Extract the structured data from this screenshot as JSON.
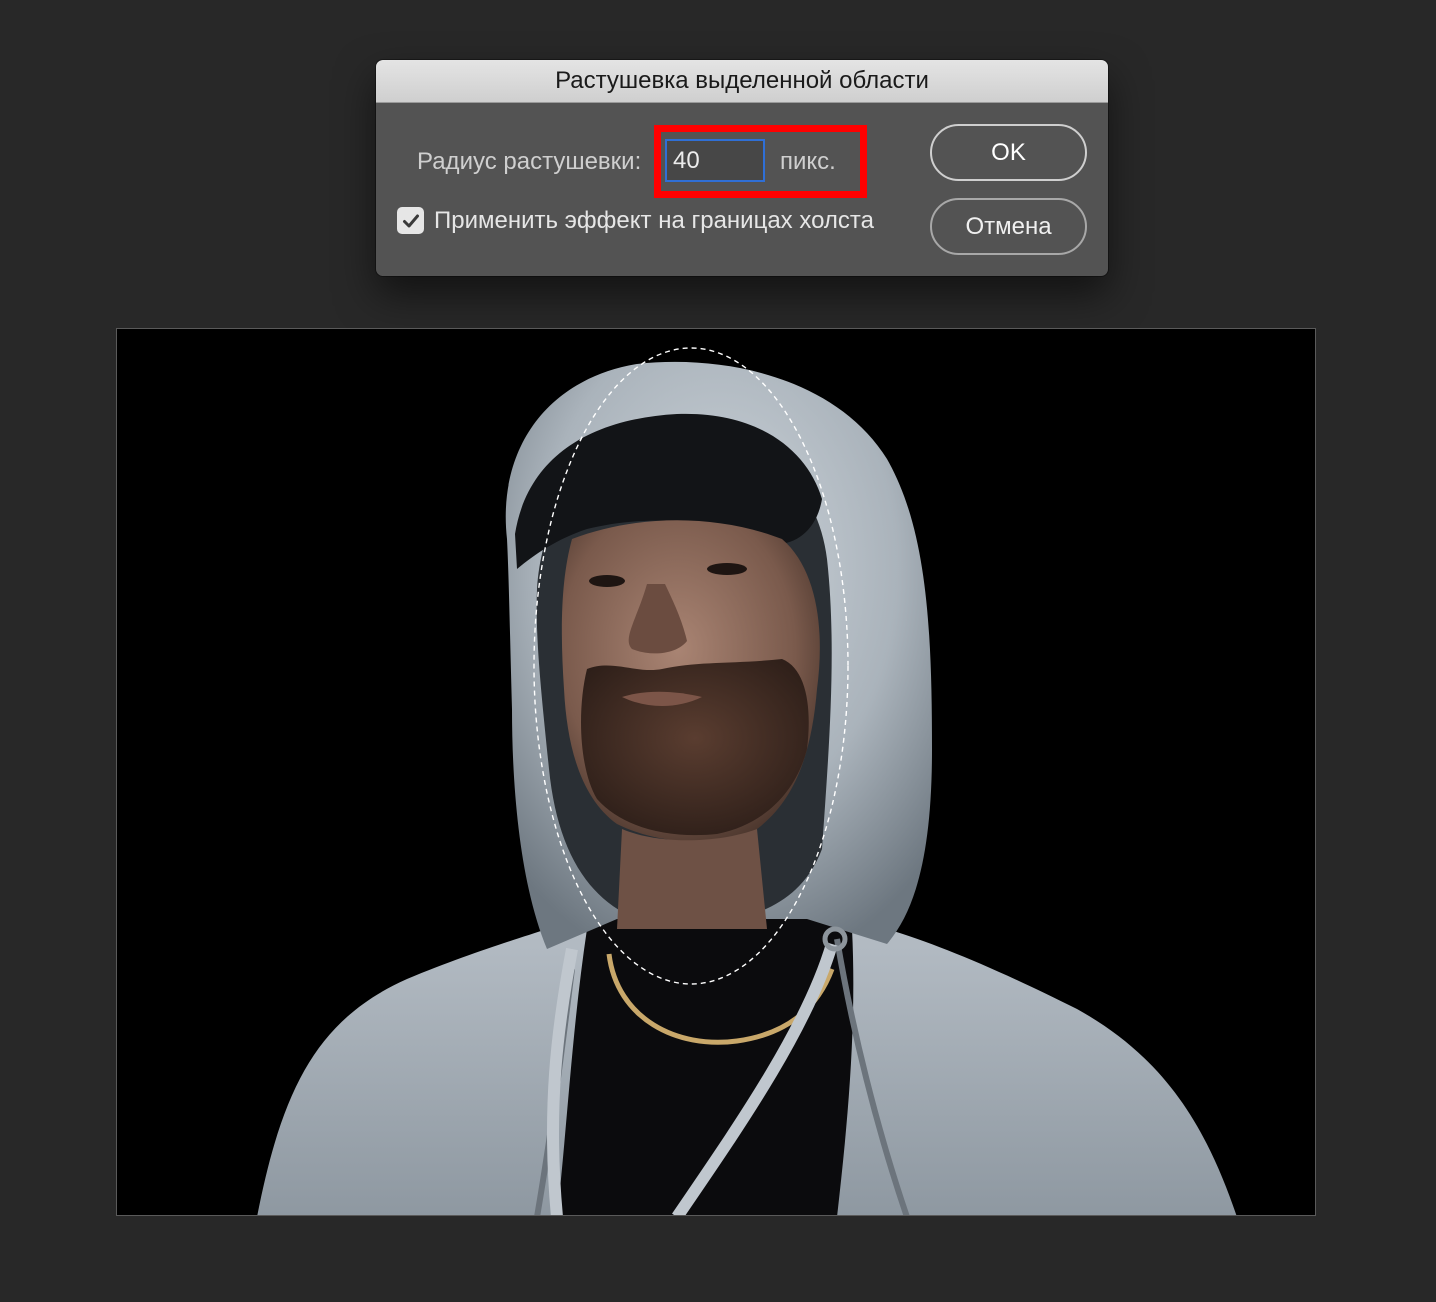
{
  "dialog": {
    "title": "Растушевка выделенной области",
    "radius_label": "Радиус растушевки:",
    "radius_value": "40",
    "unit": "пикс.",
    "checkbox_label": "Применить эффект на границах холста",
    "checkbox_checked": true,
    "ok_label": "OK",
    "cancel_label": "Отмена"
  },
  "colors": {
    "app_background": "#282828",
    "dialog_background": "#535353",
    "highlight": "#ff0000",
    "input_focus": "#2f6fd6"
  },
  "canvas": {
    "image_subject": "portrait-photo",
    "selection": "elliptical-marquee"
  }
}
